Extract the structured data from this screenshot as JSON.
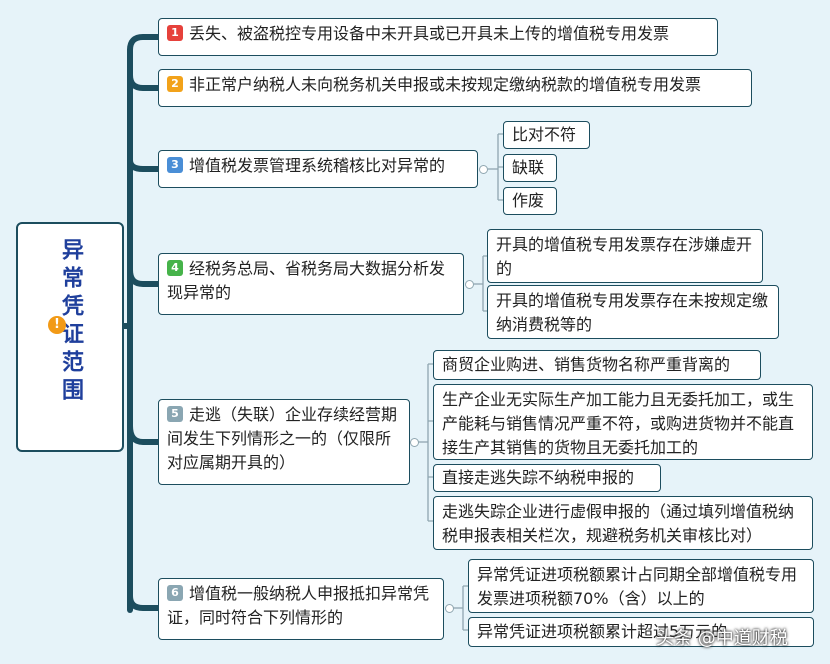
{
  "root": {
    "title": "异常凭证范围",
    "icon": "warning-icon"
  },
  "branches": [
    {
      "num": "1",
      "color": "#e6413b",
      "text": "丢失、被盗税控专用设备中未开具或已开具未上传的增值税专用发票"
    },
    {
      "num": "2",
      "color": "#f2a21a",
      "text": "非正常户纳税人未向税务机关申报或未按规定缴纳税款的增值税专用发票"
    },
    {
      "num": "3",
      "color": "#4a8ed6",
      "text": "增值税发票管理系统稽核比对异常的",
      "children": [
        "比对不符",
        "缺联",
        "作废"
      ]
    },
    {
      "num": "4",
      "color": "#46b34a",
      "text": "经税务总局、省税务局大数据分析发现异常的",
      "children": [
        "开具的增值税专用发票存在涉嫌虚开的",
        "开具的增值税专用发票存在未按规定缴纳消费税等的"
      ]
    },
    {
      "num": "5",
      "color": "#8aa6b2",
      "text": "走逃（失联）企业存续经营期间发生下列情形之一的（仅限所对应属期开具的）",
      "children": [
        "商贸企业购进、销售货物名称严重背离的",
        "生产企业无实际生产加工能力且无委托加工，或生产能耗与销售情况严重不符，或购进货物并不能直接生产其销售的货物且无委托加工的",
        "直接走逃失踪不纳税申报的",
        "走逃失踪企业进行虚假申报的（通过填列增值税纳税申报表相关栏次，规避税务机关审核比对）"
      ]
    },
    {
      "num": "6",
      "color": "#8aa6b2",
      "text": "增值税一般纳税人申报抵扣异常凭证，同时符合下列情形的",
      "children": [
        "异常凭证进项税额累计占同期全部增值税专用发票进项税额70%（含）以上的",
        "异常凭证进项税额累计超过5万元的"
      ]
    }
  ],
  "watermark": "头条 @中道财税",
  "colors": {
    "line": "#1c4d5e",
    "background": "#e6f3f9",
    "title": "#1f3f9c"
  }
}
